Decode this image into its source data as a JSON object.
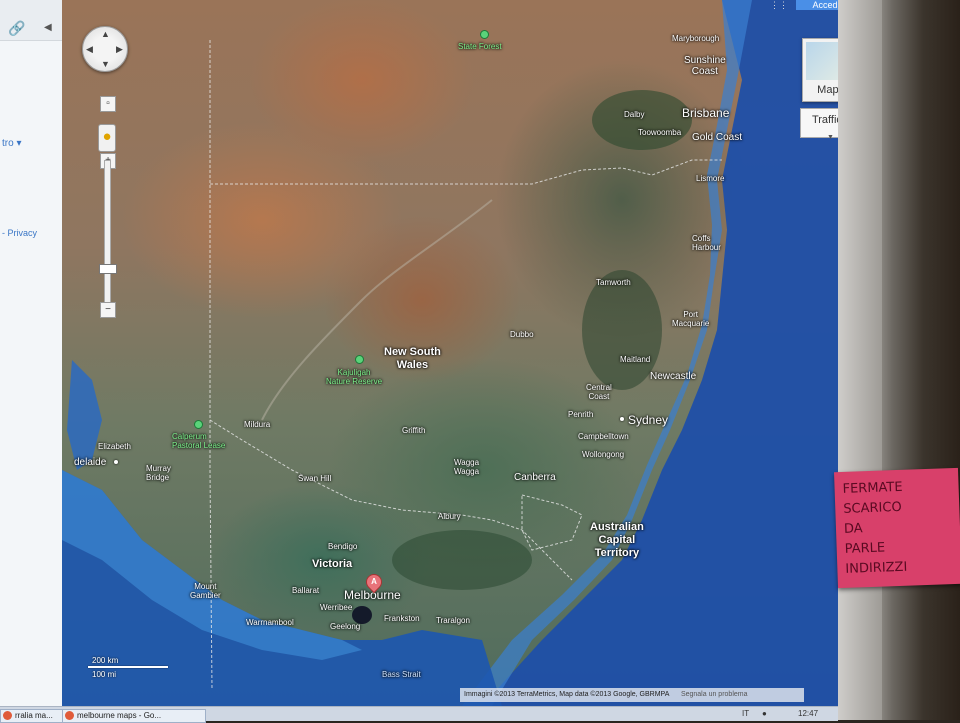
{
  "sidebar": {
    "link_icon": "link-icon",
    "partial_text": "tro ▾",
    "privacy": "- Privacy"
  },
  "top": {
    "button_label": "Accedi"
  },
  "map_type": {
    "map_label": "Mappa",
    "traffic_label": "Traffico"
  },
  "labels": {
    "state_forest": "State Forest",
    "maryborough": "Maryborough",
    "sunshine_coast": "Sunshine\nCoast",
    "brisbane": "Brisbane",
    "dalby": "Dalby",
    "toowoomba": "Toowoomba",
    "gold_coast": "Gold Coast",
    "lismore": "Lismore",
    "coffs_harbour": "Coffs\nHarbour",
    "tamworth": "Tamworth",
    "port_macquarie": "Port\nMacquarie",
    "dubbo": "Dubbo",
    "new_south_wales": "New South\nWales",
    "maitland": "Maitland",
    "newcastle": "Newcastle",
    "central_coast": "Central\nCoast",
    "sydney": "Sydney",
    "penrith": "Penrith",
    "campbelltown": "Campbelltown",
    "wollongong": "Wollongong",
    "kajuligah": "Kajuligah\nNature Reserve",
    "mildura": "Mildura",
    "calperum": "Calperum\nPastoral Lease",
    "griffith": "Griffith",
    "elizabeth": "Elizabeth",
    "adelaide": "delaide",
    "murray_bridge": "Murray\nBridge",
    "swan_hill": "Swan Hill",
    "wagga_wagga": "Wagga\nWagga",
    "canberra": "Canberra",
    "albury": "Albury",
    "act": "Australian\nCapital\nTerritory",
    "bendigo": "Bendigo",
    "victoria": "Victoria",
    "ballarat": "Ballarat",
    "melbourne": "Melbourne",
    "mount_gambier": "Mount\nGambier",
    "werribee": "Werribee",
    "frankston": "Frankston",
    "traralgon": "Traralgon",
    "warrnambool": "Warrnambool",
    "geelong": "Geelong",
    "bass_strait": "Bass Strait"
  },
  "marker": {
    "letter": "A"
  },
  "scale": {
    "km": "200 km",
    "mi": "100 mi"
  },
  "attribution": {
    "text": "Immagini ©2013 TerraMetrics, Map data ©2013 Google, GBRMPA",
    "report": "Segnala un problema"
  },
  "sticky": {
    "text": "FERMATE\nSCARICO\nDA\nPARLE\nINDIRIZZI"
  },
  "taskbar": {
    "task1": "rralia ma...",
    "task2": "melbourne maps - Go...",
    "lang": "IT",
    "time": "12:47"
  }
}
